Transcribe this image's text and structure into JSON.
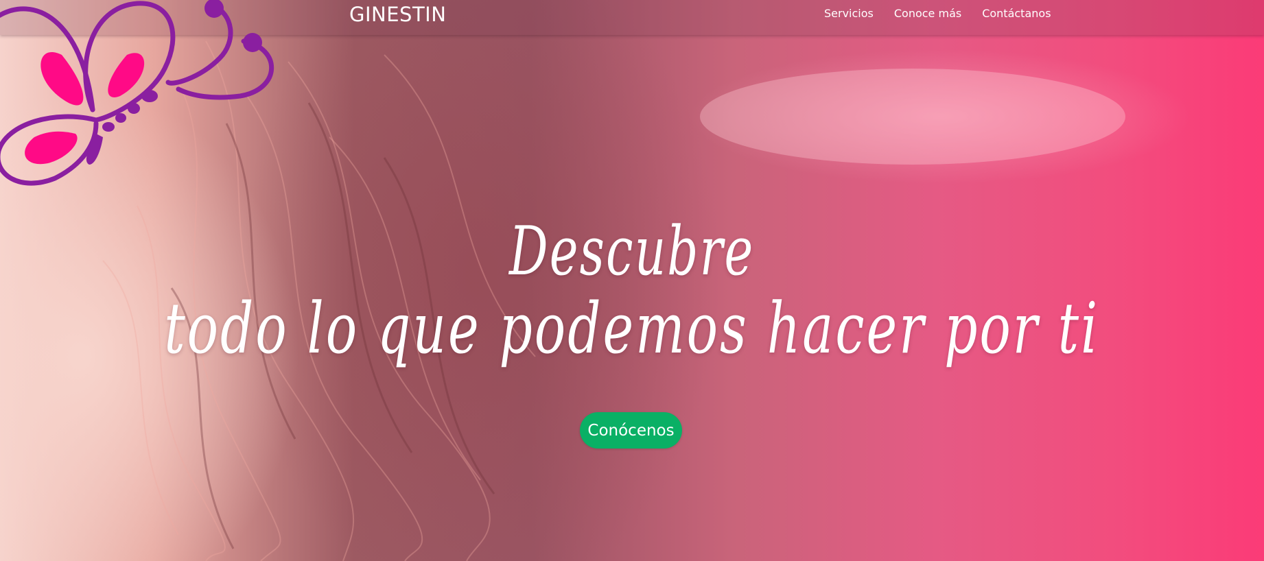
{
  "header": {
    "brand": "GINESTIN",
    "nav": [
      {
        "label": "Servicios"
      },
      {
        "label": "Conoce más"
      },
      {
        "label": "Contáctanos"
      }
    ]
  },
  "hero": {
    "headline_line1": "Descubre",
    "headline_line2": "todo lo que podemos hacer por ti",
    "cta_label": "Conócenos"
  },
  "logo": {
    "icon": "butterfly-icon"
  },
  "colors": {
    "cta": "#0ab065",
    "hero_pink": "#fb3b77",
    "logo_purple": "#8a1fa0",
    "logo_pink": "#ff0a86"
  }
}
